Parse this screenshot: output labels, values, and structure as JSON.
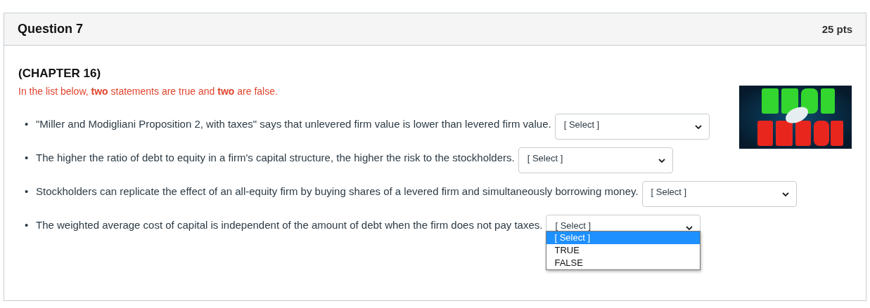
{
  "question": {
    "title": "Question 7",
    "points": "25 pts"
  },
  "chapter": "(CHAPTER 16)",
  "instruction": "In the list below, **two** statements are true and **two** are false.",
  "statements": [
    {
      "bullet": "•",
      "text": "\"Miller and Modigliani Proposition 2, with taxes\" says that unlevered firm value is lower than levered firm value.",
      "select": {
        "value": "[ Select ]"
      }
    },
    {
      "bullet": "•",
      "text": "The higher the ratio of debt to equity in a firm's capital structure, the higher the risk to the stockholders.",
      "select": {
        "value": "[ Select ]"
      }
    },
    {
      "bullet": "•",
      "text": "Stockholders can replicate the effect of an all-equity firm by buying shares of a levered firm and simultaneously borrowing money.",
      "select": {
        "value": "[ Select ]"
      }
    },
    {
      "bullet": "•",
      "text": "The weighted average cost of capital is independent of the amount of debt when the firm does not pay taxes.",
      "select": {
        "value": "[ Select ]",
        "options": [
          {
            "label": "[ Select ]",
            "selected": true
          },
          {
            "label": "TRUE",
            "selected": false
          },
          {
            "label": "FALSE",
            "selected": false
          }
        ]
      }
    }
  ]
}
